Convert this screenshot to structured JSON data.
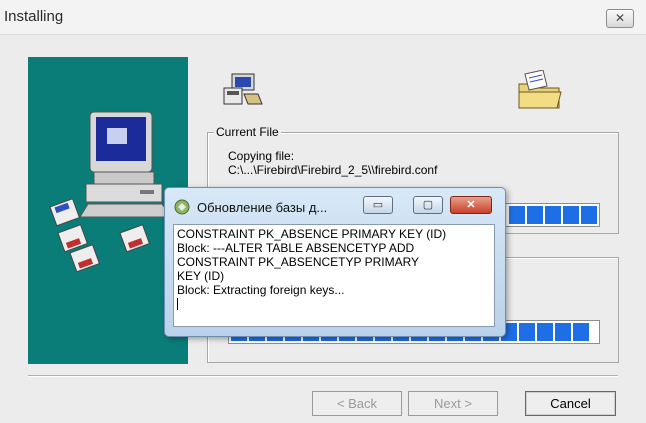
{
  "window": {
    "title": "Installing",
    "close_glyph": "✕"
  },
  "current_file": {
    "legend": "Current File",
    "action": "Copying file:",
    "path": "C:\\...\\Firebird\\Firebird_2_5\\\\firebird.conf"
  },
  "progress": {
    "file_segments_visible": 5,
    "total_segments_visible": 20,
    "color": "#1e6fe6"
  },
  "buttons": {
    "back": "< Back",
    "next": "Next >",
    "cancel": "Cancel"
  },
  "dialog": {
    "title": "Обновление базы д...",
    "minimize_glyph": "▭",
    "maximize_glyph": "▢",
    "close_glyph": "✕",
    "log_lines": [
      "CONSTRAINT PK_ABSENCE PRIMARY KEY (ID)",
      "Block: ---ALTER TABLE ABSENCETYP ADD",
      "CONSTRAINT PK_ABSENCETYP PRIMARY",
      "KEY (ID)",
      "Block: Extracting foreign keys..."
    ]
  },
  "icons": {
    "setup": "computer-setup-icon",
    "install_package": "install-package-icon",
    "folder": "open-folder-icon",
    "dialog": "database-update-icon"
  },
  "colors": {
    "panel": "#0b7d78",
    "progress": "#1e6fe6"
  }
}
